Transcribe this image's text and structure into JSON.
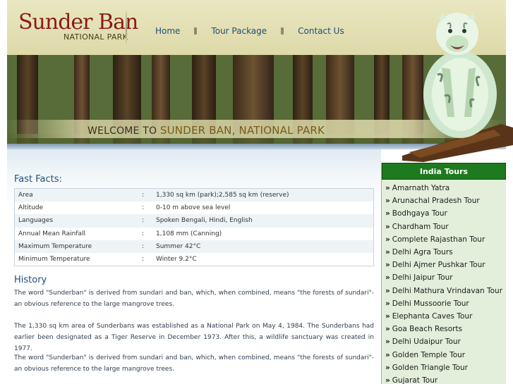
{
  "logo": {
    "title": "Sunder Ban",
    "subtitle": "NATIONAL PARK"
  },
  "nav": {
    "items": [
      "Home",
      "Tour Package",
      "Contact Us"
    ]
  },
  "banner": {
    "welcome_prefix": "WELCOME TO",
    "welcome_highlight": "SUNDER BAN, NATIONAL PARK"
  },
  "fast_facts": {
    "heading": "Fast Facts:",
    "rows": [
      {
        "label": "Area",
        "value": "1,330 sq km (park);2,585 sq km (reserve)"
      },
      {
        "label": "Altitude",
        "value": "0-10 m above sea level"
      },
      {
        "label": "Languages",
        "value": "Spoken Bengali, Hindi, English"
      },
      {
        "label": "Annual Mean Rainfall",
        "value": "1,108 mm (Canning)"
      },
      {
        "label": "Maximum Temperature",
        "value": "Summer 42°C"
      },
      {
        "label": "Minimum Temperature",
        "value": "Winter 9.2°C"
      }
    ]
  },
  "history": {
    "heading": "History",
    "paragraphs": [
      "The word \"Sunderban\" is derived from sundari and ban, which, when combined, means \"the forests of sundari\"-an obvious reference to the large mangrove trees.",
      "The 1,330 sq km area of Sunderbans was established as a National Park on May 4, 1984. The Sunderbans had earlier been designated as a Tiger Reserve in December 1973. After this, a wildlife sanctuary was created in 1977.",
      "The word \"Sunderban\" is derived from sundari and ban, which, when combined, means \"the forests of sundari\"-an obvious reference to the large mangrove trees."
    ]
  },
  "sidebar": {
    "title": "India Tours",
    "bullet": "»",
    "items": [
      "Amarnath Yatra",
      "Arunachal Pradesh Tour",
      "Bodhgaya Tour",
      "Chardham Tour",
      "Complete Rajasthan Tour",
      "Delhi Agra Tours",
      "Delhi Ajmer Pushkar Tour",
      "Delhi Jaipur Tour",
      "Delhi Mathura Vrindavan Tour",
      "Delhi Mussoorie Tour",
      "Elephanta Caves Tour",
      "Goa Beach Resorts",
      "Delhi Udaipur Tour",
      "Golden Temple Tour",
      "Golden Triangle Tour",
      "Gujarat Tour"
    ]
  },
  "colors": {
    "logo": "#8c1b12",
    "nav": "#1c4f7a",
    "heading": "#1d4e7d",
    "sidebar_header": "#1e7a1e"
  }
}
